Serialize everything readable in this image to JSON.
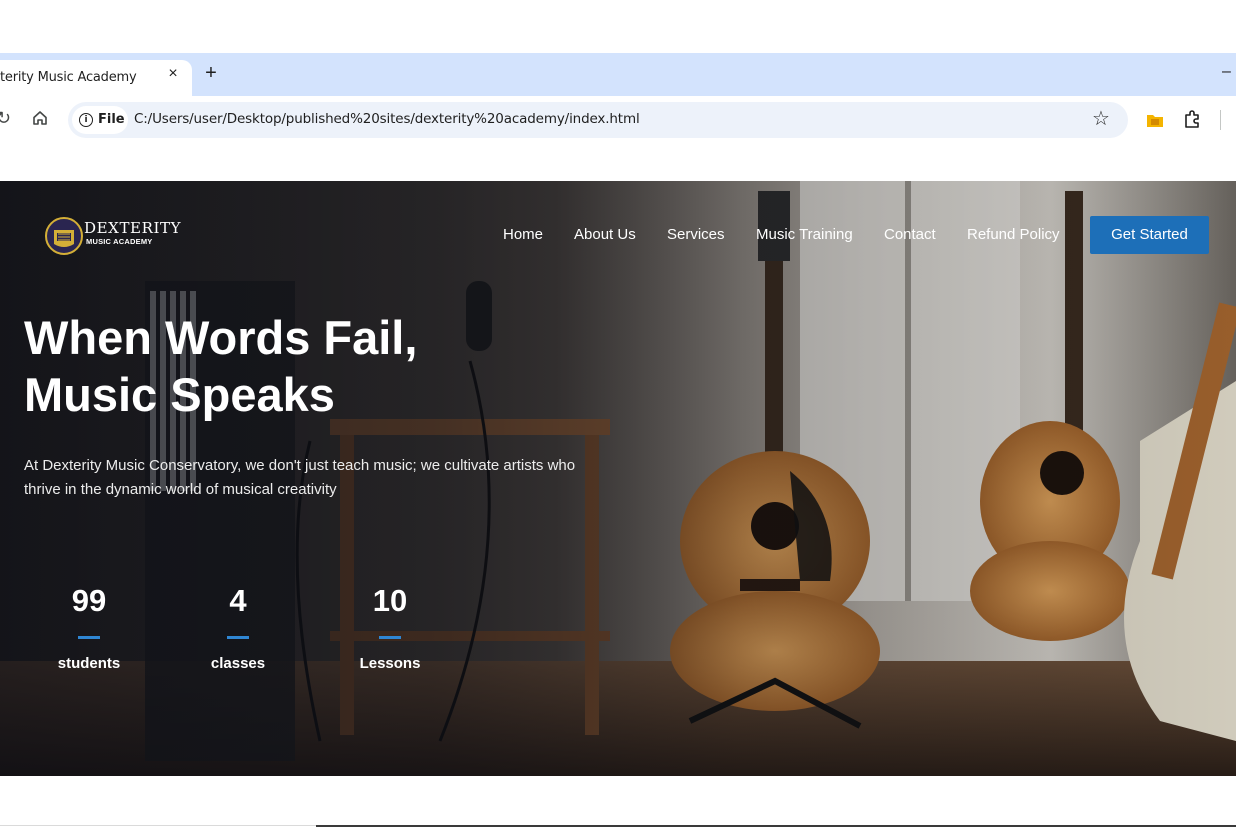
{
  "browser": {
    "tab_title": "terity Music Academy",
    "tab_close": "×",
    "new_tab": "+",
    "minimize": "–",
    "site_chip": "File",
    "url": "C:/Users/user/Desktop/published%20sites/dexterity%20academy/index.html",
    "bookmark_icon": "star-icon"
  },
  "site": {
    "logo": {
      "name": "DEXTERITY",
      "sub": "MUSIC ACADEMY"
    },
    "nav": [
      "Home",
      "About Us",
      "Services",
      "Music Training",
      "Contact",
      "Refund Policy"
    ],
    "cta": "Get Started",
    "headline": [
      "When Words Fail,",
      "Music Speaks"
    ],
    "subtext": "At Dexterity Music Conservatory, we don't just teach music; we cultivate artists who thrive in the dynamic world of musical creativity",
    "stats": [
      {
        "value": "99",
        "label": "students"
      },
      {
        "value": "4",
        "label": "classes"
      },
      {
        "value": "10",
        "label": "Lessons"
      }
    ]
  },
  "colors": {
    "tabstrip": "#d3e3fd",
    "omnibox": "#edf2fa",
    "accent": "#1d6fb8",
    "stat_bar": "#2f86d3"
  }
}
